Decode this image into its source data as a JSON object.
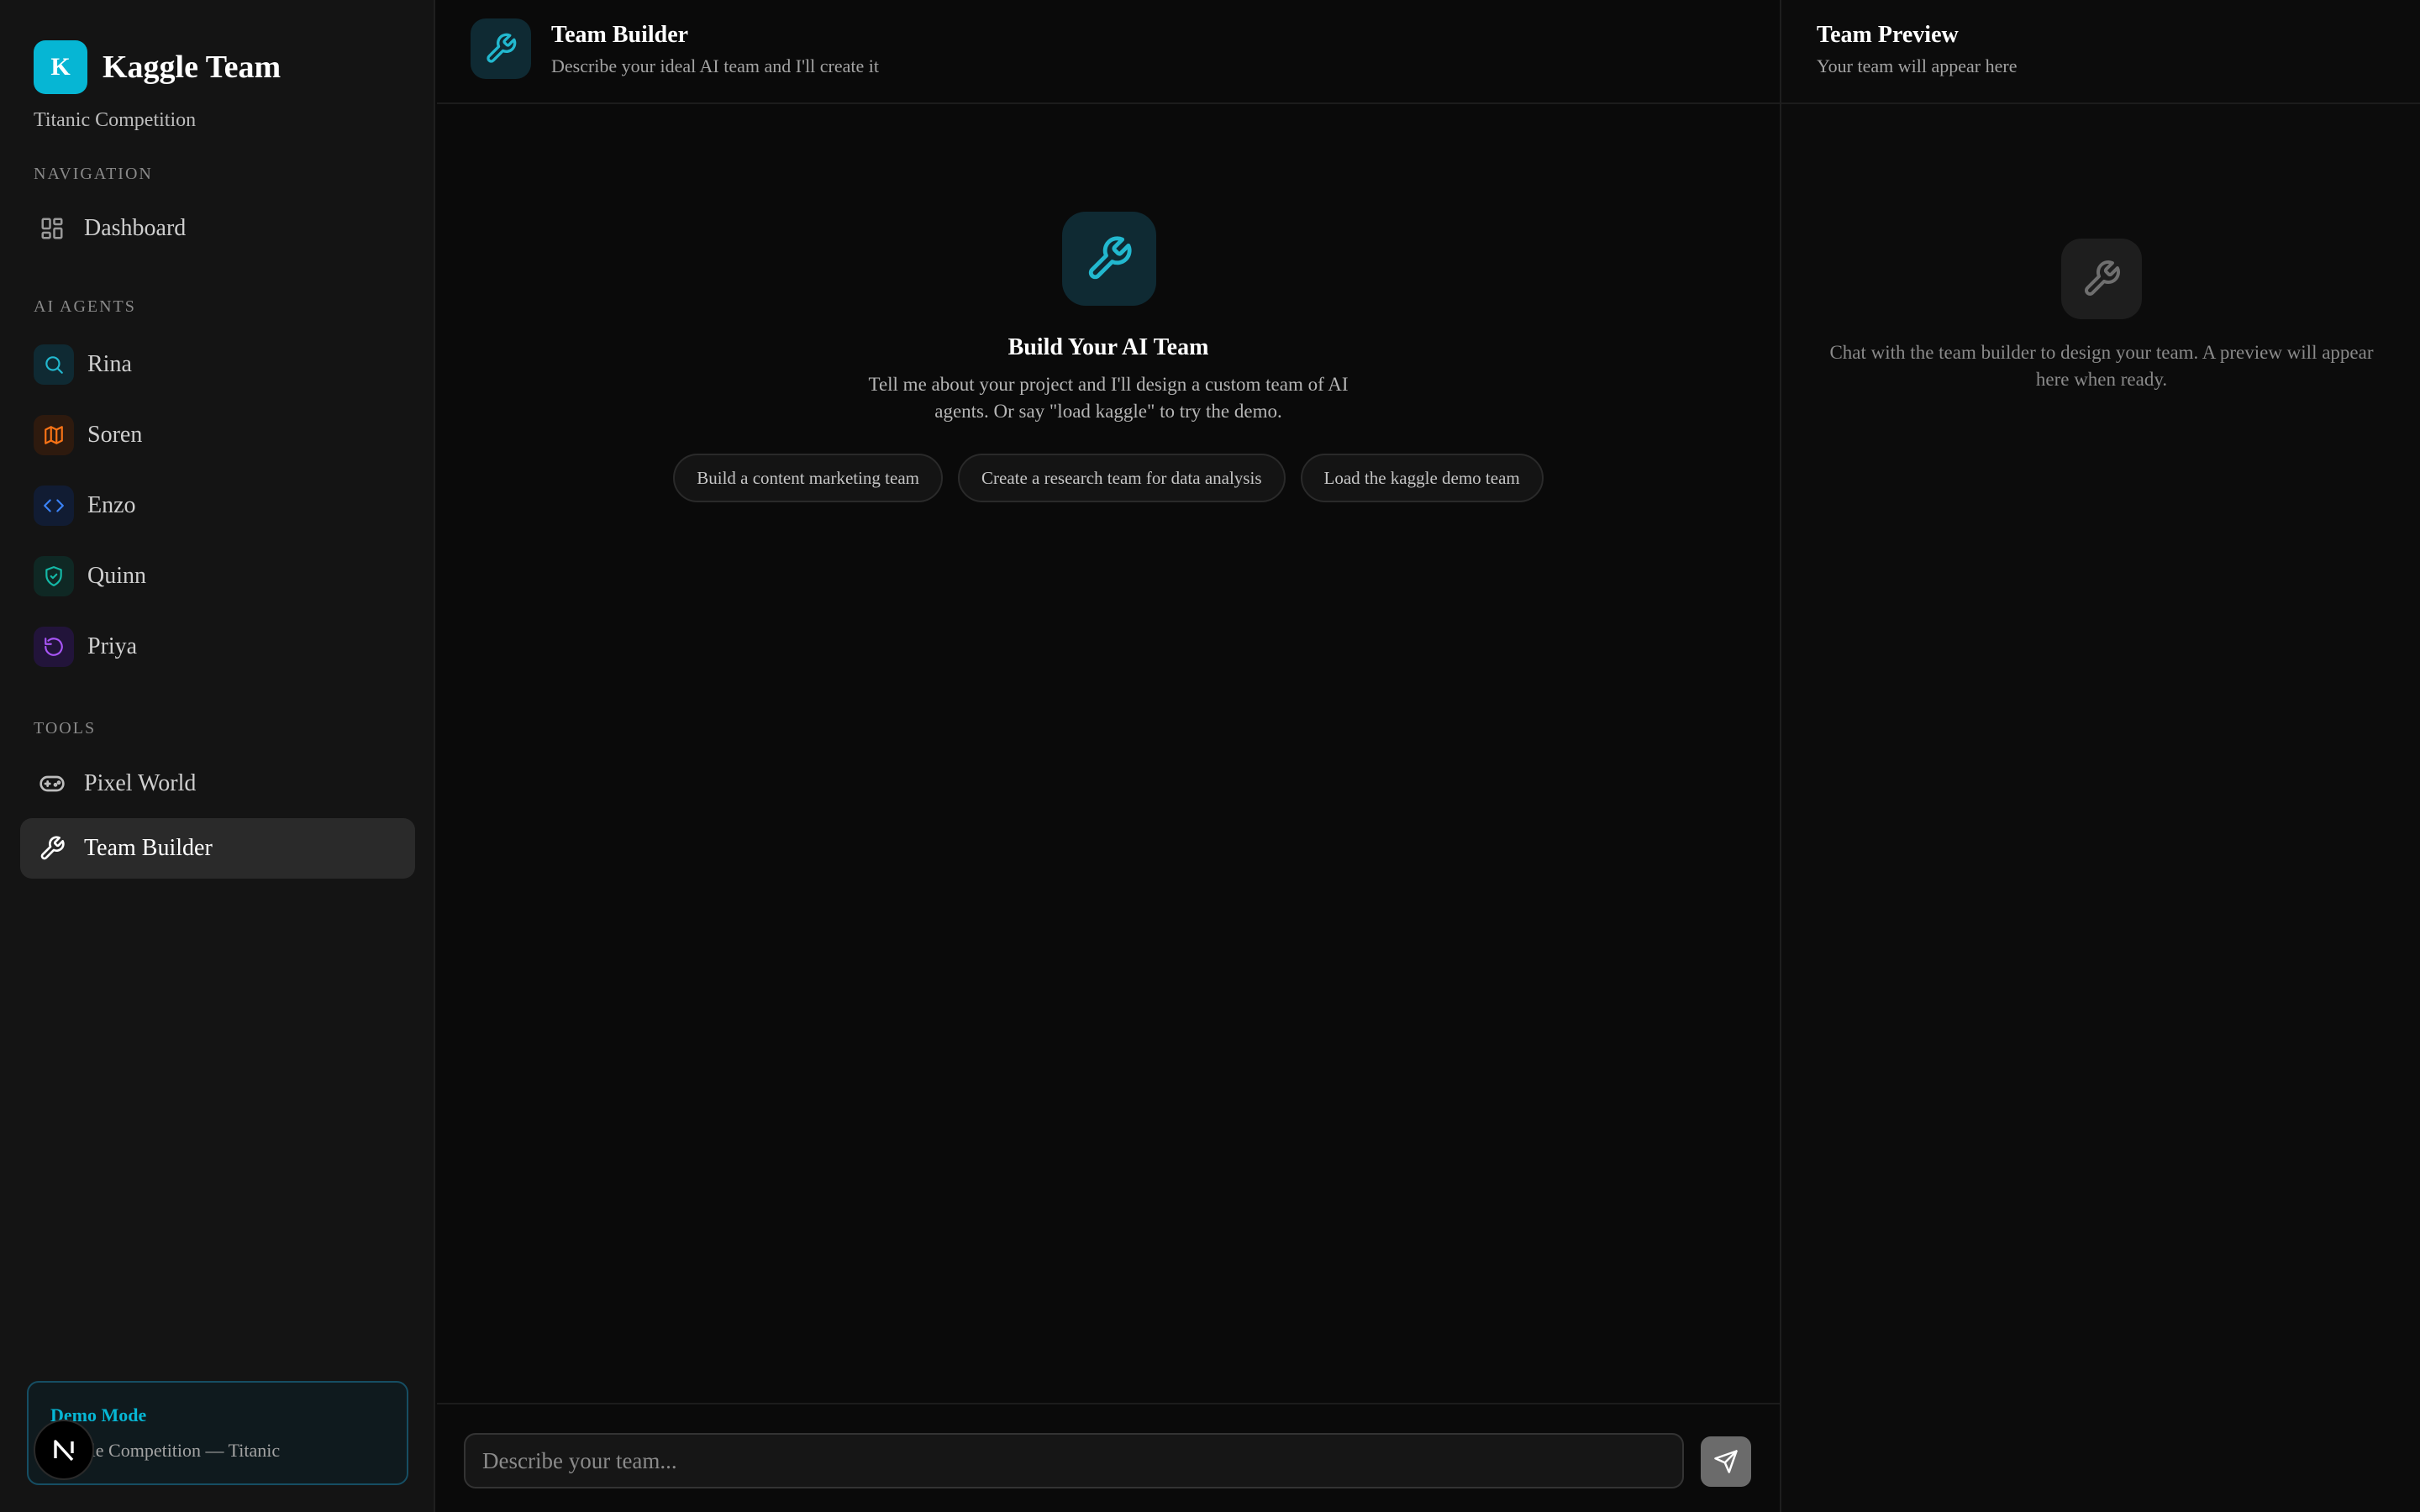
{
  "sidebar": {
    "brand_letter": "K",
    "brand_name": "Kaggle Team",
    "brand_subtitle": "Titanic Competition",
    "navigation_label": "NAVIGATION",
    "dashboard_label": "Dashboard",
    "agents_label": "AI AGENTS",
    "agents": [
      {
        "name": "Rina",
        "icon": "search-icon",
        "color": "#22b8cf"
      },
      {
        "name": "Soren",
        "icon": "map-icon",
        "color": "#f97316"
      },
      {
        "name": "Enzo",
        "icon": "code-icon",
        "color": "#3b82f6"
      },
      {
        "name": "Quinn",
        "icon": "shield-check-icon",
        "color": "#14b8a6"
      },
      {
        "name": "Priya",
        "icon": "rotate-icon",
        "color": "#a855f7"
      }
    ],
    "tools_label": "TOOLS",
    "tools": [
      {
        "name": "Pixel World",
        "icon": "gamepad-icon"
      },
      {
        "name": "Team Builder",
        "icon": "wrench-icon",
        "active": true
      }
    ],
    "demo": {
      "title": "Demo Mode",
      "subtitle": "Kaggle Competition — Titanic"
    },
    "n_badge": "N"
  },
  "main": {
    "header_title": "Team Builder",
    "header_subtitle": "Describe your ideal AI team and I'll create it",
    "hero_title": "Build Your AI Team",
    "hero_text": "Tell me about your project and I'll design a custom team of AI agents. Or say \"load kaggle\" to try the demo.",
    "suggestions": [
      "Build a content marketing team",
      "Create a research team for data analysis",
      "Load the kaggle demo team"
    ],
    "input_placeholder": "Describe your team...",
    "input_value": ""
  },
  "preview": {
    "title": "Team Preview",
    "subtitle": "Your team will appear here",
    "empty_text": "Chat with the team builder to design your team. A preview will appear here when ready."
  },
  "colors": {
    "accent": "#06b6d4",
    "background": "#0a0a0a",
    "sidebar": "#141414"
  }
}
